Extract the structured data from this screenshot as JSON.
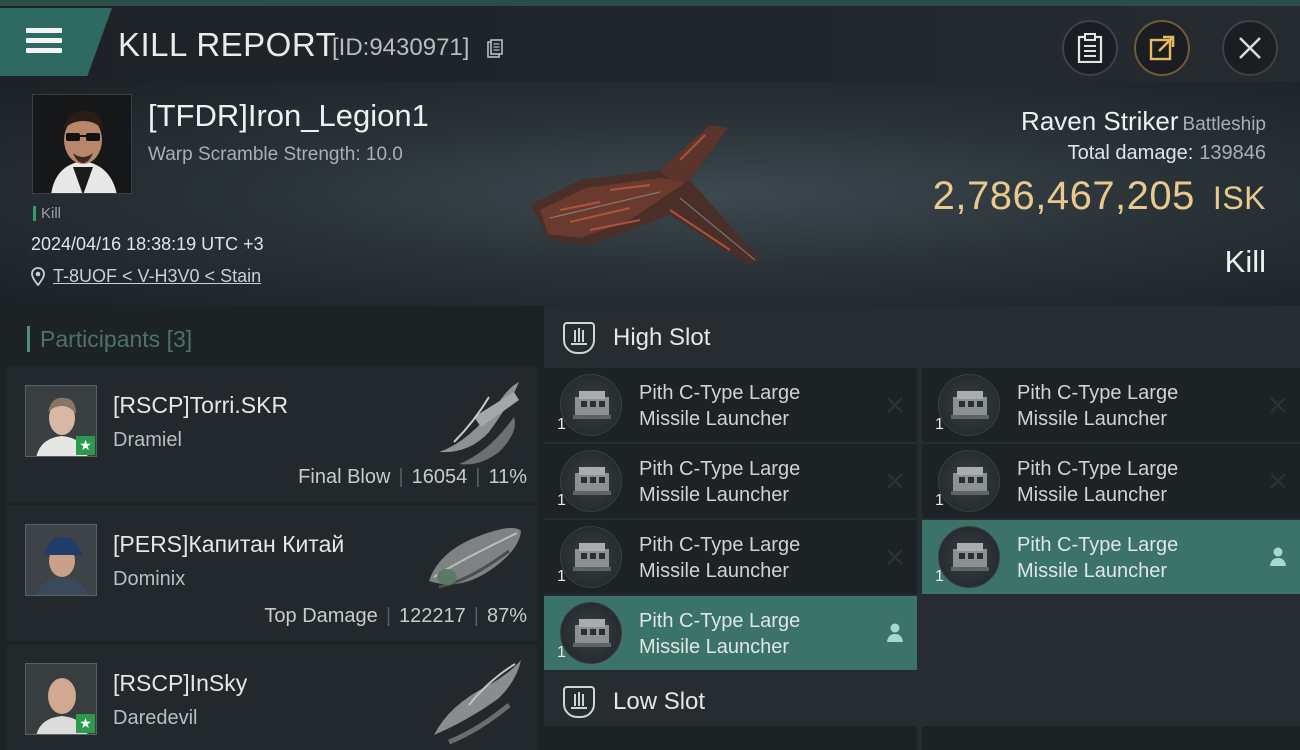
{
  "header": {
    "title": "KILL REPORT",
    "report_id": "[ID:9430971]"
  },
  "victim": {
    "pilot_name": "[TFDR]Iron_Legion1",
    "warp_scramble_label": "Warp Scramble Strength:",
    "warp_scramble_value": "10.0",
    "kill_badge": "Kill",
    "datetime": "2024/04/16 18:38:19 UTC +3",
    "location": "T-8UOF < V-H3V0 < Stain",
    "ship_name": "Raven Striker",
    "ship_class": "Battleship",
    "total_damage_label": "Total damage:",
    "total_damage_value": "139846",
    "isk_value": "2,786,467,205",
    "isk_unit": "ISK",
    "result": "Kill"
  },
  "participants": {
    "title": "Participants",
    "count": "[3]",
    "list": [
      {
        "name": "[RSCP]Torri.SKR",
        "ship": "Dramiel",
        "role": "Final Blow",
        "damage": "16054",
        "percent": "11%",
        "starred": true
      },
      {
        "name": "[PERS]Капитан Китай",
        "ship": "Dominix",
        "role": "Top Damage",
        "damage": "122217",
        "percent": "87%",
        "starred": false
      },
      {
        "name": "[RSCP]InSky",
        "ship": "Daredevil",
        "role": "",
        "damage": "",
        "percent": "",
        "starred": true
      }
    ]
  },
  "fitting": {
    "high_slot_title": "High Slot",
    "low_slot_title": "Low Slot",
    "high_slot_modules": [
      {
        "name_line1": "Pith C-Type Large",
        "name_line2": "Missile Launcher",
        "qty": "1",
        "status": "destroyed"
      },
      {
        "name_line1": "Pith C-Type Large",
        "name_line2": "Missile Launcher",
        "qty": "1",
        "status": "destroyed"
      },
      {
        "name_line1": "Pith C-Type Large",
        "name_line2": "Missile Launcher",
        "qty": "1",
        "status": "destroyed"
      },
      {
        "name_line1": "Pith C-Type Large",
        "name_line2": "Missile Launcher",
        "qty": "1",
        "status": "destroyed"
      },
      {
        "name_line1": "Pith C-Type Large",
        "name_line2": "Missile Launcher",
        "qty": "1",
        "status": "destroyed"
      },
      {
        "name_line1": "Pith C-Type Large",
        "name_line2": "Missile Launcher",
        "qty": "1",
        "status": "dropped"
      },
      {
        "name_line1": "Pith C-Type Large",
        "name_line2": "Missile Launcher",
        "qty": "1",
        "status": "dropped"
      }
    ]
  },
  "colors": {
    "accent_teal": "#3c7368",
    "isk_gold": "#e9c98c",
    "star_green": "#2b9a4e"
  },
  "icons": [
    "menu-icon",
    "copy-icon",
    "clipboard-icon",
    "share-icon",
    "close-icon",
    "location-pin-icon",
    "star-icon",
    "slot-icon",
    "destroyed-x-icon",
    "person-icon"
  ]
}
